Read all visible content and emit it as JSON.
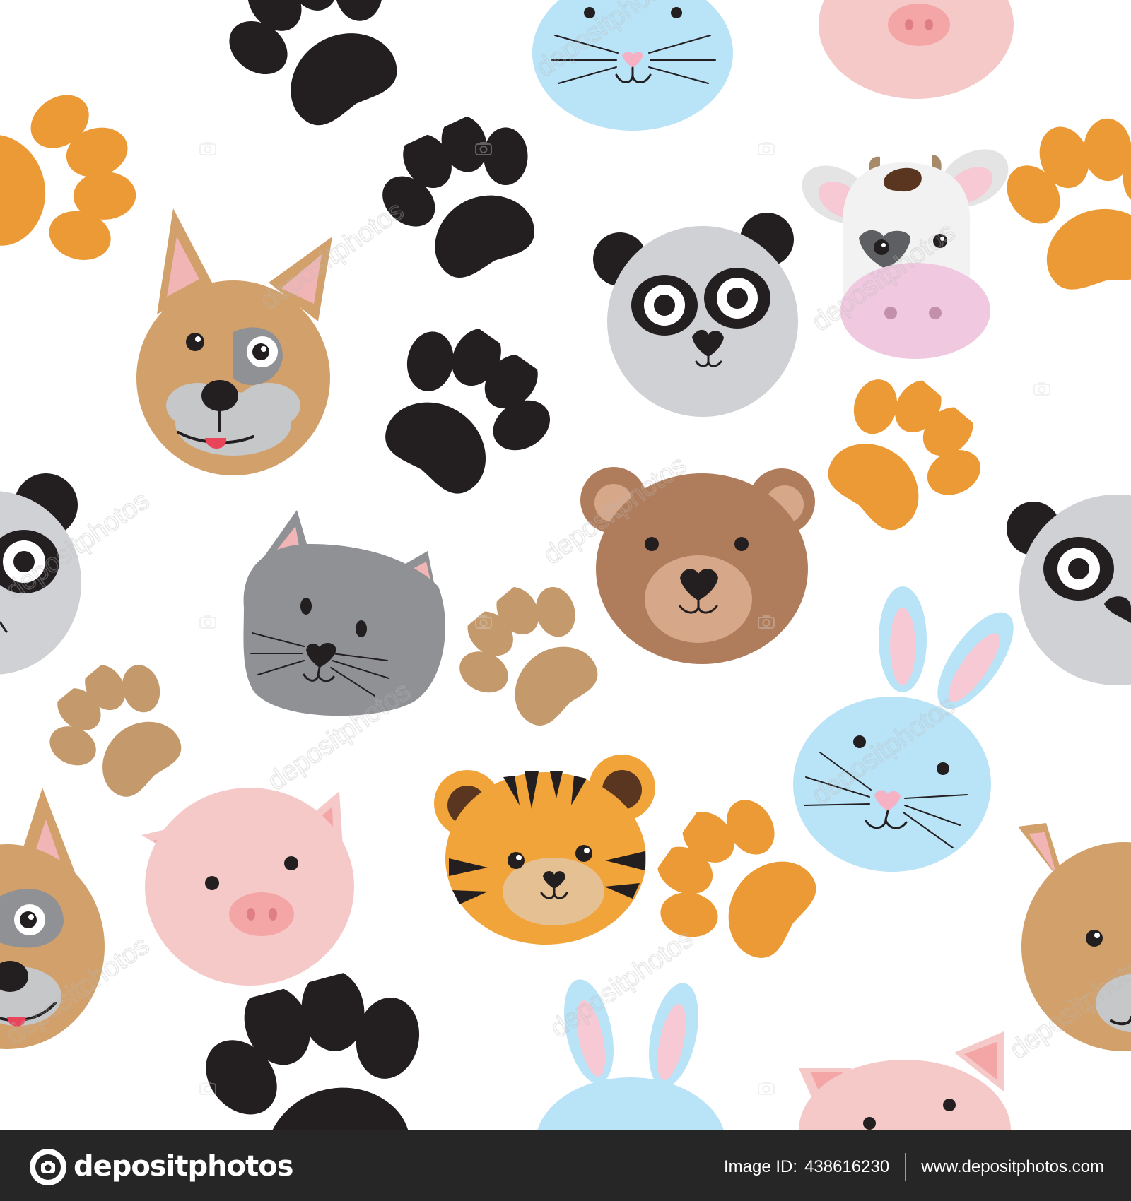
{
  "image": {
    "subject": "seamless pattern of cute cartoon animal faces and paw prints on white background",
    "animals": [
      "dog",
      "panda",
      "cow",
      "rabbit",
      "pig",
      "bear",
      "cat",
      "tiger"
    ],
    "colors": {
      "background": "#ffffff",
      "paw_black": "#231f20",
      "paw_orange": "#ec9a35",
      "paw_tan": "#c49a6c",
      "dog": "#d2a06a",
      "panda": "#cfd1d4",
      "rabbit": "#b9e3f7",
      "pig": "#f6c9c9",
      "bear": "#b07d5c",
      "cat": "#8f9195",
      "tiger": "#f0a43a",
      "cow": "#f2f2f2",
      "footer": "#262626"
    }
  },
  "watermark": {
    "text": "depositphotos"
  },
  "footer": {
    "brand": "depositphotos",
    "id_label": "Image ID:",
    "id_value": "438616230",
    "site": "www.depositphotos.com"
  }
}
